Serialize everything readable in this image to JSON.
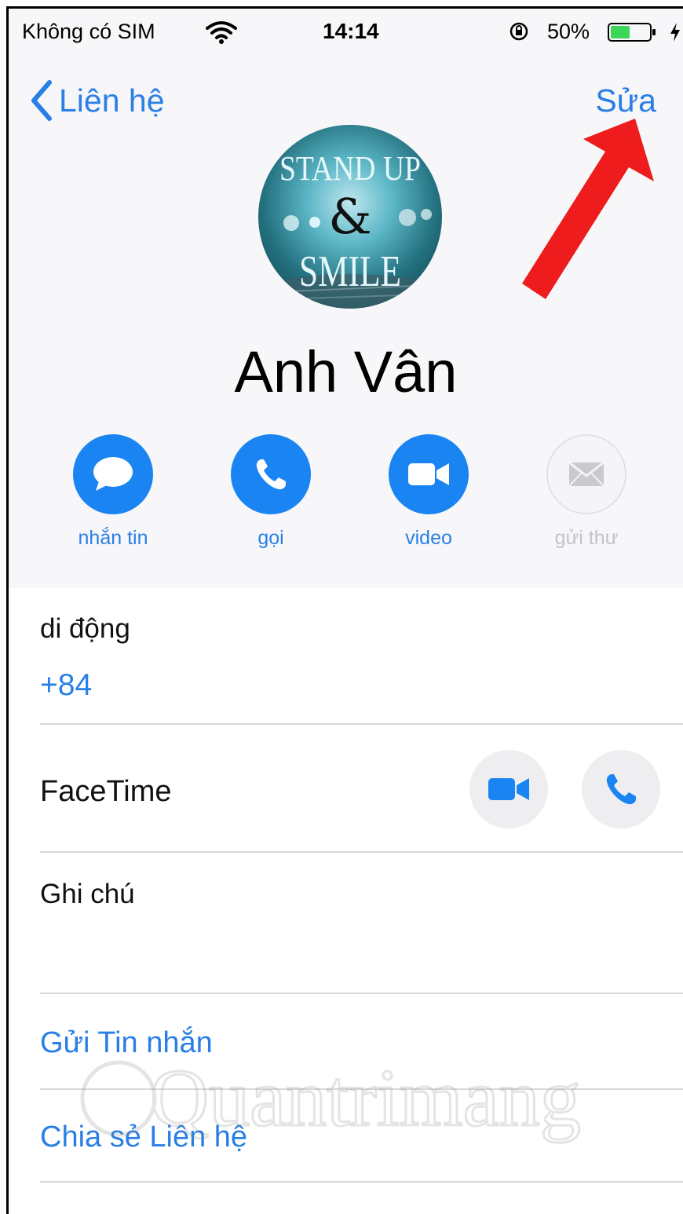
{
  "status_bar": {
    "carrier": "Không có SIM",
    "time": "14:14",
    "battery_percent": "50%",
    "battery_level": 0.5
  },
  "nav": {
    "back_label": "Liên hệ",
    "edit_label": "Sửa"
  },
  "avatar": {
    "line1": "STAND UP",
    "line2": "&",
    "line3": "SMILE"
  },
  "contact": {
    "name": "Anh Vân"
  },
  "actions": [
    {
      "label": "nhắn tin",
      "icon": "message-bubble-icon",
      "enabled": true
    },
    {
      "label": "gọi",
      "icon": "phone-icon",
      "enabled": true
    },
    {
      "label": "video",
      "icon": "video-camera-icon",
      "enabled": true
    },
    {
      "label": "gửi thư",
      "icon": "mail-envelope-icon",
      "enabled": false
    }
  ],
  "phone": {
    "label": "di động",
    "number": "+84"
  },
  "facetime": {
    "label": "FaceTime",
    "video_icon": "video-camera-icon",
    "audio_icon": "phone-icon"
  },
  "notes": {
    "label": "Ghi chú"
  },
  "links": {
    "send_message": "Gửi Tin nhắn",
    "share_contact": "Chia sẻ Liên hệ"
  },
  "watermark": {
    "text": "Quantrimang"
  },
  "colors": {
    "accent": "#1a84f2",
    "link": "#2a7fe6",
    "arrow": "#ee1c1c",
    "battery_fill": "#3bd65a"
  }
}
